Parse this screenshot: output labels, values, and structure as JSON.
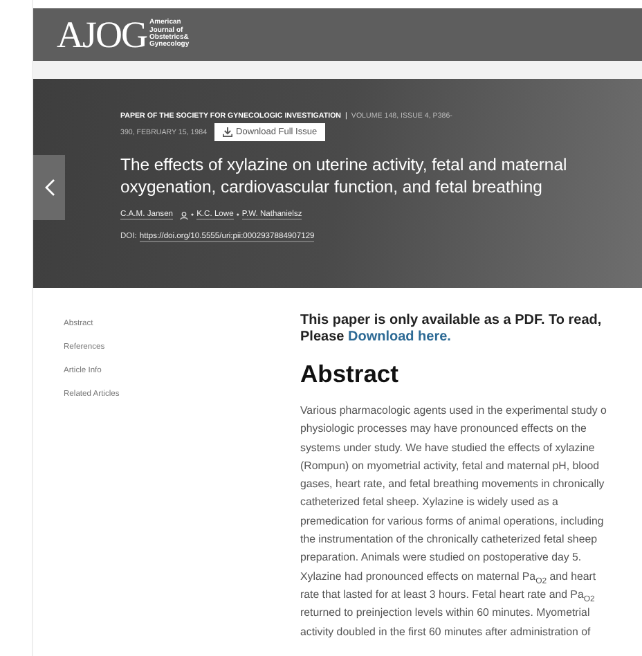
{
  "header": {
    "logo": "AJOG",
    "journal_lines": [
      "American",
      "Journal of",
      "Obstetrics&",
      "Gynecology"
    ]
  },
  "article": {
    "series": "PAPER OF THE SOCIETY FOR GYNECOLOGIC INVESTIGATION",
    "separator": "|",
    "issue_lines": [
      "VOLUME 148, ISSUE 4, P386-",
      "390, FEBRUARY 15, 1984"
    ],
    "download_button": "Download Full Issue",
    "title_lines": [
      "The effects of xylazine on uterine activity, fetal and maternal",
      "oxygenation, cardiovascular function, and fetal breathing"
    ],
    "authors": [
      {
        "name": "C.A.M. Jansen",
        "contact": true
      },
      {
        "name": "K.C. Lowe",
        "contact": false
      },
      {
        "name": "P.W. Nathanielsz",
        "contact": false
      }
    ],
    "author_separator": "•",
    "doi_label": "DOI:",
    "doi": "https://doi.org/10.5555/uri:pii:0002937884907129"
  },
  "sidebar": {
    "items": [
      {
        "label": "Abstract"
      },
      {
        "label": "References"
      },
      {
        "label": "Article Info"
      },
      {
        "label": "Related Articles"
      }
    ]
  },
  "notice": {
    "text": "This paper is only available as a PDF. To read,",
    "prefix": "Please",
    "link": "Download here."
  },
  "abstract": {
    "heading": "Abstract",
    "lines": [
      "Various pharmacologic agents used in the experimental study o",
      "physiologic processes may have pronounced effects on the",
      "systems under study. We have studied the effects of xylazine",
      "(Rompun) on myometrial activity, fetal and maternal pH, blood",
      "gases, heart rate, and fetal breathing movements in chronically",
      "catheterized fetal sheep. Xylazine is widely used as a",
      "premedication for various forms of animal operations, including",
      "the instrumentation of the chronically catheterized fetal sheep",
      "preparation. Animals were studied on postoperative day 5.",
      "Xylazine had pronounced effects on maternal Pa$_{O2}$ and heart",
      "rate that lasted for at least 3 hours. Fetal heart rate and Pa$_{O2}$",
      "returned to preinjection levels within 60 minutes. Myometrial",
      "activity doubled in the first 60 minutes after administration of"
    ]
  }
}
